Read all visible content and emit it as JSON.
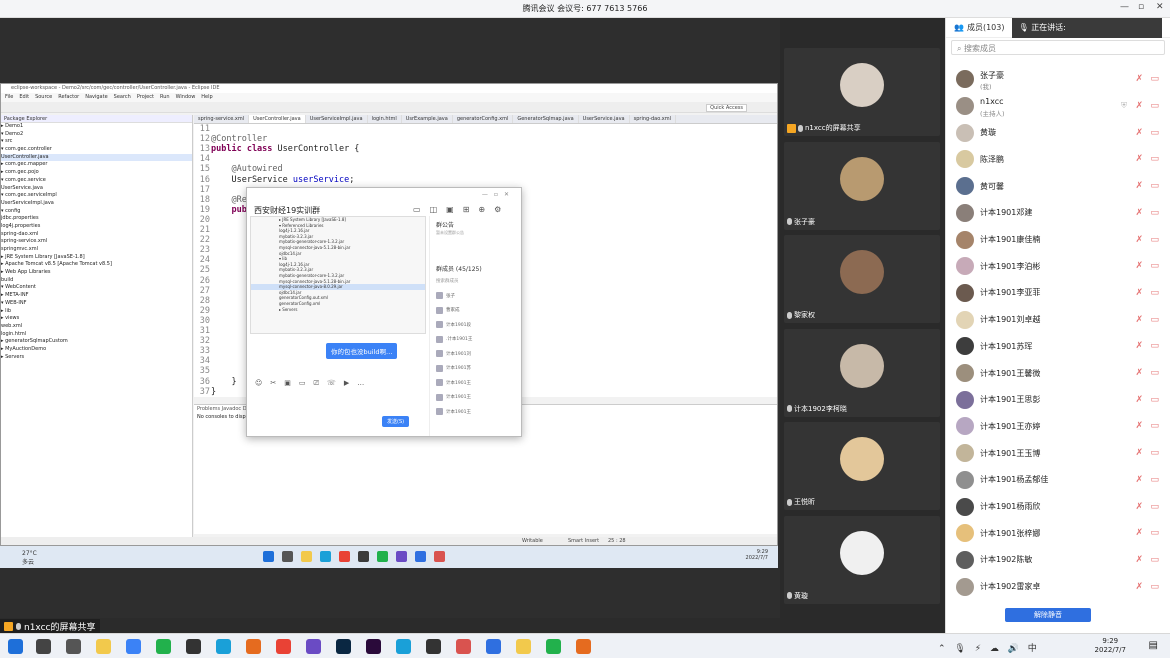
{
  "meeting": {
    "title": "腾讯会议 会议号: 677 7613 5766",
    "win_min": "—",
    "win_max": "▫",
    "win_close": "✕"
  },
  "eclipse": {
    "title": "eclipse-workspace - Demo2/src/com/gec/controller/UserController.java - Eclipse IDE",
    "menu": [
      "File",
      "Edit",
      "Source",
      "Refactor",
      "Navigate",
      "Search",
      "Project",
      "Run",
      "Window",
      "Help"
    ],
    "quick_access": "Quick Access",
    "package_explorer_title": "Package Explorer",
    "package_tree": [
      "▸ Demo1",
      "▾ Demo2",
      "  ▾ src",
      "    ▾ com.gec.controller",
      "      UserController.java",
      "    ▸ com.gec.mapper",
      "    ▸ com.gec.pojo",
      "    ▾ com.gec.service",
      "      UserService.java",
      "    ▾ com.gec.serviceImpl",
      "      UserServiceImpl.java",
      "  ▾ config",
      "      jdbc.properties",
      "      log4j.properties",
      "      spring-dao.xml",
      "      spring-service.xml",
      "      springmvc.xml",
      "  ▸ JRE System Library [JavaSE-1.8]",
      "  ▸ Apache Tomcat v8.5 [Apache Tomcat v8.5]",
      "  ▸ Web App Libraries",
      "    build",
      "  ▾ WebContent",
      "    ▸ META-INF",
      "    ▾ WEB-INF",
      "      ▸ lib",
      "      ▸ views",
      "        web.xml",
      "      login.html",
      "▸ generatorSqlmapCustom",
      "▸ MyAuctionDemo",
      "▸ Servers"
    ],
    "editor_tabs": [
      "spring-service.xml",
      "UserController.java",
      "UserServiceImpl.java",
      "login.html",
      "UsrExample.java",
      "generatorConfig.xml",
      "GeneratorSqlmap.java",
      "UserService.java",
      "spring-dao.xml"
    ],
    "code_lines": [
      {
        "n": "11",
        "t": "",
        "k": "plain"
      },
      {
        "n": "12",
        "t": "@Controller",
        "k": "an"
      },
      {
        "n": "13",
        "t": "public class UserController {",
        "k": "kwline"
      },
      {
        "n": "14",
        "t": "",
        "k": "plain"
      },
      {
        "n": "15",
        "t": "    @Autowired",
        "k": "an"
      },
      {
        "n": "16",
        "t": "    UserService userService;",
        "k": "field"
      },
      {
        "n": "17",
        "t": "",
        "k": "plain"
      },
      {
        "n": "18",
        "t": "    @Req",
        "k": "an"
      },
      {
        "n": "19",
        "t": "    publ",
        "k": "kw"
      },
      {
        "n": "20",
        "t": "",
        "k": "plain"
      },
      {
        "n": "21",
        "t": "",
        "k": "plain"
      },
      {
        "n": "22",
        "t": "",
        "k": "plain"
      },
      {
        "n": "23",
        "t": "",
        "k": "plain"
      },
      {
        "n": "24",
        "t": "",
        "k": "plain"
      },
      {
        "n": "25",
        "t": "",
        "k": "plain"
      },
      {
        "n": "26",
        "t": "",
        "k": "plain"
      },
      {
        "n": "27",
        "t": "",
        "k": "plain"
      },
      {
        "n": "28",
        "t": "",
        "k": "plain"
      },
      {
        "n": "29",
        "t": "",
        "k": "plain"
      },
      {
        "n": "30",
        "t": "",
        "k": "plain"
      },
      {
        "n": "31",
        "t": "",
        "k": "plain"
      },
      {
        "n": "32",
        "t": "",
        "k": "plain"
      },
      {
        "n": "33",
        "t": "",
        "k": "plain"
      },
      {
        "n": "34",
        "t": "",
        "k": "plain"
      },
      {
        "n": "35",
        "t": "",
        "k": "plain"
      },
      {
        "n": "36",
        "t": "    }",
        "k": "plain"
      },
      {
        "n": "37",
        "t": "}",
        "k": "plain"
      }
    ],
    "console_tabs": "Problems  Javadoc  Declaration  Console",
    "console_msg": "No consoles to display at this time.",
    "status_writable": "Writable",
    "status_insert": "Smart Insert",
    "status_pos": "25 : 28"
  },
  "wechat": {
    "group_title": "西安财经19实训群",
    "announcement_title": "群公告",
    "announcement_sub": "暂未设置群公告",
    "members_label": "群成员 (45/125)",
    "search_members": "搜索群成员",
    "member_list": [
      "张子",
      "曹家成",
      "计本1901段",
      ".计本1901王",
      "计本1901刘",
      "计本1901苏",
      "计本1901王",
      "计本1901王",
      "计本1901王"
    ],
    "shot_lines": [
      "▸ JRE System Library [JavaSE-1.8]",
      "▾ Referenced Libraries",
      "  log4j-1.2.16.jar",
      "  mybatis-3.2.3.jar",
      "  mybatis-generator-core-1.3.2.jar",
      "  mysql-connector-java-5.1.28-bin.jar",
      "  ojdbc14.jar",
      "▾ lib",
      "  log4j-1.2.16.jar",
      "  mybatis-3.2.3.jar",
      "  mybatis-generator-core-1.3.2.jar",
      "  mysql-connector-java-5.1.28-bin.jar",
      "  mysql-connector-java-8.0.29.jar",
      "  ojdbc14.jar",
      "  generatorConfig.out.xml",
      "  generatorConfig.xml",
      "▸ Servers"
    ],
    "bubble": "你的包也没build啊…",
    "send": "发送(S)"
  },
  "inner_taskbar": {
    "weather_temp": "27°C",
    "weather_desc": "多云",
    "tray_time": "9:29",
    "tray_date": "2022/7/7"
  },
  "share_label": "n1xcc的屏幕共享",
  "tiles": [
    {
      "label": "n1xcc的屏幕共享",
      "color": "#d9cfc4"
    },
    {
      "label": "张子豪",
      "color": "#b89a70"
    },
    {
      "label": "黎家权",
      "color": "#8c6a52"
    },
    {
      "label": "计本1902李柯晓",
      "color": "#c7b9a8"
    },
    {
      "label": "王悦昕",
      "color": "#e3c79a"
    },
    {
      "label": "黄璇",
      "color": "#f0f0f0"
    }
  ],
  "panel": {
    "members_tab": "成员(103)",
    "speaking": "正在讲话:",
    "search_placeholder": "搜索成员",
    "unmute_btn": "解除静音",
    "members": [
      {
        "name": "张子豪",
        "sub": "(我)",
        "color": "#7a6b5d"
      },
      {
        "name": "n1xcc",
        "sub": "(主持人)",
        "color": "#9a8f85"
      },
      {
        "name": "黄璇",
        "sub": "",
        "color": "#c9bfb5"
      },
      {
        "name": "陈泽鹏",
        "sub": "",
        "color": "#d8c9a0"
      },
      {
        "name": "黄可馨",
        "sub": "",
        "color": "#5b6f8f"
      },
      {
        "name": "计本1901邓建",
        "sub": "",
        "color": "#8a7f79"
      },
      {
        "name": "计本1901康佳楠",
        "sub": "",
        "color": "#a5846a"
      },
      {
        "name": "计本1901李泊彬",
        "sub": "",
        "color": "#c7aab8"
      },
      {
        "name": "计本1901李亚菲",
        "sub": "",
        "color": "#6b5a4f"
      },
      {
        "name": "计本1901刘卓越",
        "sub": "",
        "color": "#e2d4b5"
      },
      {
        "name": "计本1901苏珲",
        "sub": "",
        "color": "#3d3d3d"
      },
      {
        "name": "计本1901王馨微",
        "sub": "",
        "color": "#9c8f7d"
      },
      {
        "name": "计本1901王思彭",
        "sub": "",
        "color": "#7b6f9a"
      },
      {
        "name": "计本1901王亦婷",
        "sub": "",
        "color": "#b7a7c2"
      },
      {
        "name": "计本1901王玉博",
        "sub": "",
        "color": "#c2b59a"
      },
      {
        "name": "计本1901杨孟郁佳",
        "sub": "",
        "color": "#8f8f8f"
      },
      {
        "name": "计本1901杨雨欣",
        "sub": "",
        "color": "#4a4a4a"
      },
      {
        "name": "计本1901张梓娜",
        "sub": "",
        "color": "#e6c07b"
      },
      {
        "name": "计本1902陈敏",
        "sub": "",
        "color": "#5e5e5e"
      },
      {
        "name": "计本1902雷家卓",
        "sub": "",
        "color": "#a39a90"
      }
    ]
  },
  "taskbar": {
    "time": "9:29",
    "date": "2022/7/7",
    "tray_text": "中"
  },
  "colors": {
    "accent": "#2f6fe0",
    "muted_red": "#e57373",
    "share_orange": "#f5a623"
  }
}
